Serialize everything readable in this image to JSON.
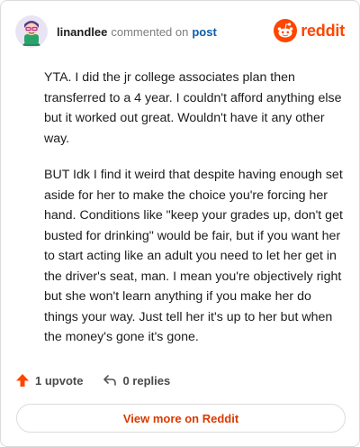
{
  "header": {
    "username": "linandlee",
    "action": "commented on",
    "target": "post",
    "avatar_icon": "avatar-icon",
    "brand_icon": "reddit-snoo-icon",
    "brand": "reddit",
    "brand_color": "#ff4500"
  },
  "comment": {
    "paragraphs": [
      "YTA. I did the jr college associates plan then transferred to a 4 year. I couldn't afford anything else but it worked out great. Wouldn't have it any other way.",
      "BUT Idk I find it weird that despite having enough set aside for her to make the choice you're forcing her hand. Conditions like \"keep your grades up, don't get busted for drinking\" would be fair, but if you want her to start acting like an adult you need to let her get in the driver's seat, man. I mean you're objectively right but she won't learn anything if you make her do things your way. Just tell her it's up to her but when the money's gone it's gone."
    ]
  },
  "actions": {
    "upvote_icon": "upvote-arrow-icon",
    "upvote_label": "1 upvote",
    "upvote_color": "#ff4500",
    "reply_icon": "reply-arrow-icon",
    "reply_label": "0 replies"
  },
  "footer": {
    "view_more_label": "View more on Reddit",
    "link_color": "#d93a00"
  }
}
